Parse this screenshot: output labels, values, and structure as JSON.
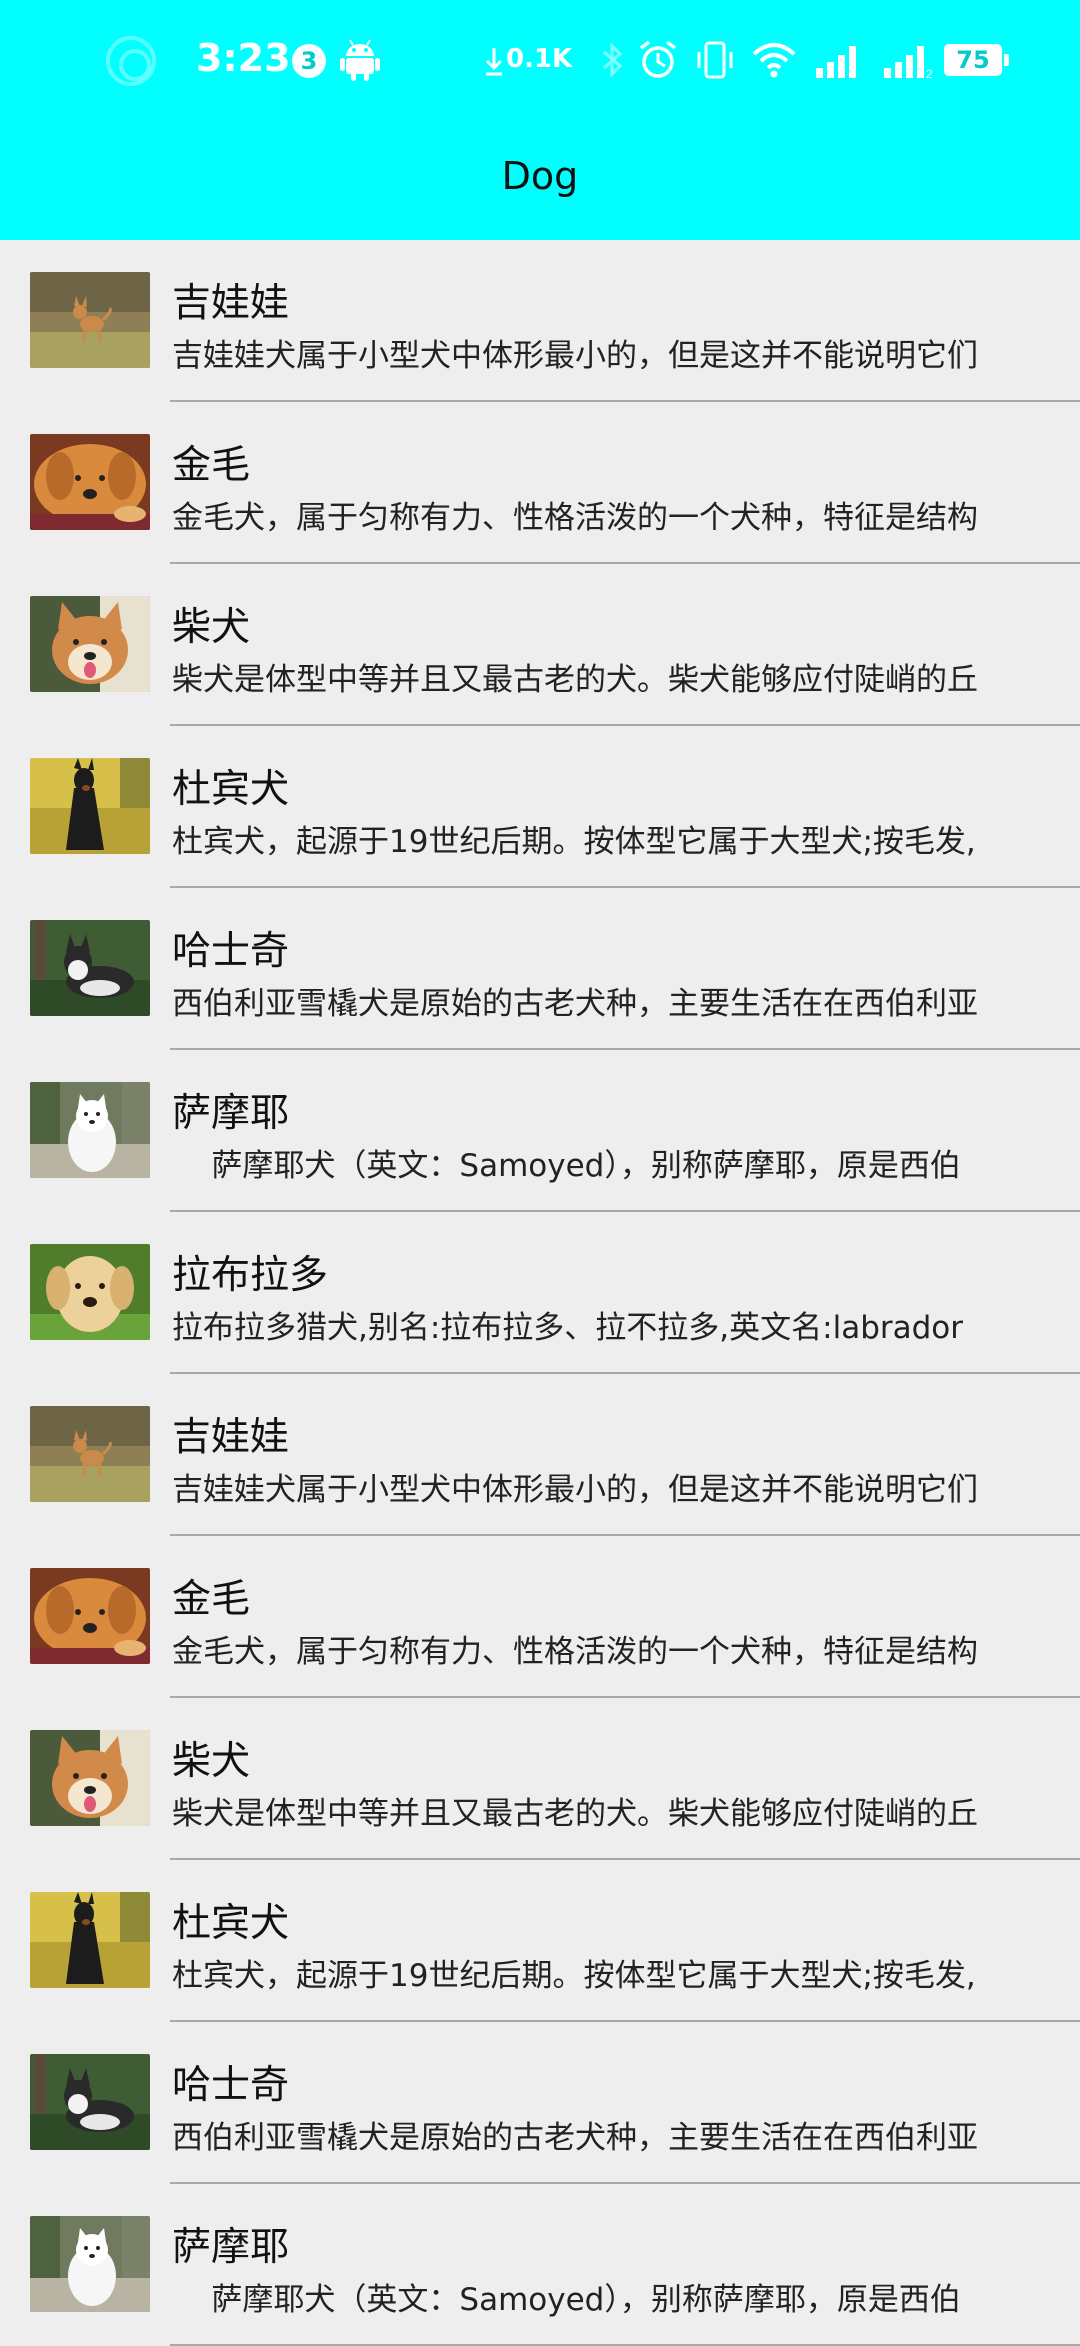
{
  "status_bar": {
    "time": "3:23",
    "notification_count": "3",
    "net_speed": "0.1K",
    "battery": "75",
    "icons": [
      "android-icon",
      "download-arrow-icon",
      "bluetooth-icon",
      "alarm-icon",
      "vibrate-icon",
      "wifi-icon",
      "signal-icon",
      "signal-2-icon"
    ]
  },
  "app_bar": {
    "title": "Dog"
  },
  "colors": {
    "app_bar": "#00ffff",
    "background": "#eeeeee",
    "divider": "#a8a8a8"
  },
  "items": [
    {
      "name": "吉娃娃",
      "desc": "吉娃娃犬属于小型犬中体形最小的，但是这并不能说明它们",
      "thumb": "chihuahua"
    },
    {
      "name": "金毛",
      "desc": "金毛犬，属于匀称有力、性格活泼的一个犬种，特征是结构",
      "thumb": "golden"
    },
    {
      "name": "柴犬",
      "desc": "柴犬是体型中等并且又最古老的犬。柴犬能够应付陡峭的丘",
      "thumb": "shiba"
    },
    {
      "name": "杜宾犬",
      "desc": "杜宾犬，起源于19世纪后期。按体型它属于大型犬;按毛发,",
      "thumb": "doberman"
    },
    {
      "name": "哈士奇",
      "desc": "西伯利亚雪橇犬是原始的古老犬种，主要生活在在西伯利亚",
      "thumb": "husky"
    },
    {
      "name": "萨摩耶",
      "desc": "    萨摩耶犬（英文：Samoyed），别称萨摩耶，原是西伯",
      "thumb": "samoyed"
    },
    {
      "name": "拉布拉多",
      "desc": "拉布拉多猎犬,别名:拉布拉多、拉不拉多,英文名:labrador",
      "thumb": "labrador"
    },
    {
      "name": "吉娃娃",
      "desc": "吉娃娃犬属于小型犬中体形最小的，但是这并不能说明它们",
      "thumb": "chihuahua"
    },
    {
      "name": "金毛",
      "desc": "金毛犬，属于匀称有力、性格活泼的一个犬种，特征是结构",
      "thumb": "golden"
    },
    {
      "name": "柴犬",
      "desc": "柴犬是体型中等并且又最古老的犬。柴犬能够应付陡峭的丘",
      "thumb": "shiba"
    },
    {
      "name": "杜宾犬",
      "desc": "杜宾犬，起源于19世纪后期。按体型它属于大型犬;按毛发,",
      "thumb": "doberman"
    },
    {
      "name": "哈士奇",
      "desc": "西伯利亚雪橇犬是原始的古老犬种，主要生活在在西伯利亚",
      "thumb": "husky"
    },
    {
      "name": "萨摩耶",
      "desc": "    萨摩耶犬（英文：Samoyed），别称萨摩耶，原是西伯",
      "thumb": "samoyed"
    }
  ]
}
